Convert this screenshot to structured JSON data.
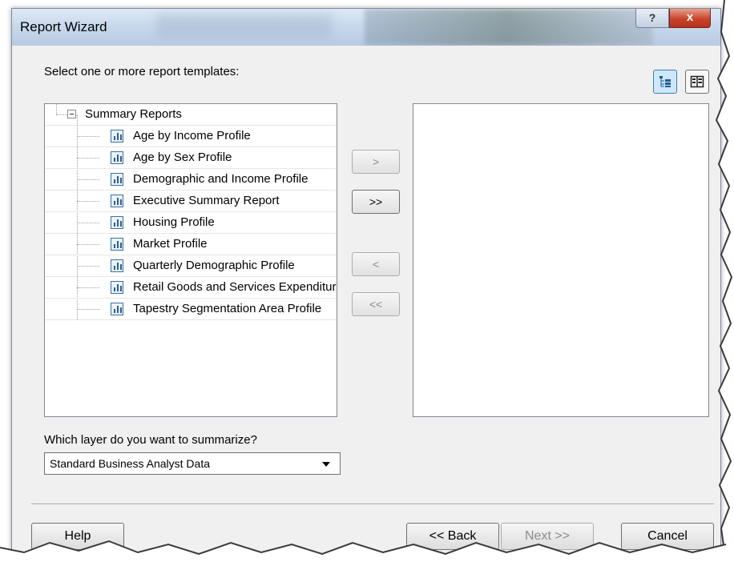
{
  "window": {
    "title": "Report Wizard",
    "help_glyph": "?",
    "close_glyph": "x"
  },
  "main": {
    "prompt": "Select one or more report templates:",
    "tree": {
      "root_label": "Summary Reports",
      "items": [
        {
          "label": "Age by Income Profile"
        },
        {
          "label": "Age by Sex Profile"
        },
        {
          "label": "Demographic and Income Profile"
        },
        {
          "label": "Executive Summary Report"
        },
        {
          "label": "Housing Profile"
        },
        {
          "label": "Market Profile"
        },
        {
          "label": "Quarterly Demographic Profile"
        },
        {
          "label": "Retail Goods and Services Expenditure"
        },
        {
          "label": "Tapestry Segmentation Area Profile"
        }
      ]
    },
    "transfer_buttons": {
      "add": ">",
      "add_all": ">>",
      "remove": "<",
      "remove_all": "<<"
    },
    "layer_question": "Which layer do you want to summarize?",
    "layer_selected": "Standard Business Analyst Data"
  },
  "footer": {
    "help": "Help",
    "back": "<< Back",
    "next": "Next >>",
    "cancel": "Cancel"
  },
  "icons": {
    "tree_view": "tree-view-icon",
    "list_view": "list-view-icon",
    "report": "report-icon"
  },
  "colors": {
    "title_gradient_start": "#dfe9f5",
    "close_button": "#c8442c",
    "active_view_button": "#cfe6fb"
  }
}
